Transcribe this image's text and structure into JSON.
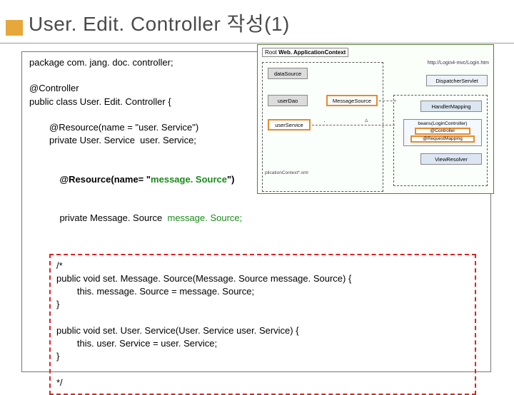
{
  "title": "User. Edit. Controller 작성(1)",
  "code": {
    "l1": "package com. jang. doc. controller;",
    "l2": "@Controller",
    "l3": "public class User. Edit. Controller {",
    "l4": "@Resource(name = \"user. Service\")",
    "l5": "private User. Service  user. Service;",
    "l6a": "@Resource(name= \"",
    "l6b": "message. Source",
    "l6c": "\")",
    "l7a": "private Message. Source  ",
    "l7b": "message. Source;"
  },
  "commented": {
    "c1": "/*",
    "c2": "public void set. Message. Source(Message. Source message. Source) {",
    "c3": "        this. message. Source = message. Source;",
    "c4": "}",
    "c5": "public void set. User. Service(User. Service user. Service) {",
    "c6": "        this. user. Service = user. Service;",
    "c7": "}",
    "c8": "*/"
  },
  "diagram": {
    "root_label_prefix": "Root ",
    "root_label_bold": "Web. ApplicationContext",
    "url": "http://Login4-mvc/Login.htm",
    "datasource": "dataSource",
    "userdao": "userDao",
    "userservice": "userService",
    "msgsource": "MessageSource",
    "dispatcher": "DispatcherServlet",
    "handlermap": "HandlerMapping",
    "beans_label": "beans(LoginController)",
    "ctrl_anno": "@Controller",
    "reqmap_anno": "@RequestMapping",
    "viewresolver": "ViewResolver",
    "ctx_xml": "plicationContext*.xml"
  }
}
